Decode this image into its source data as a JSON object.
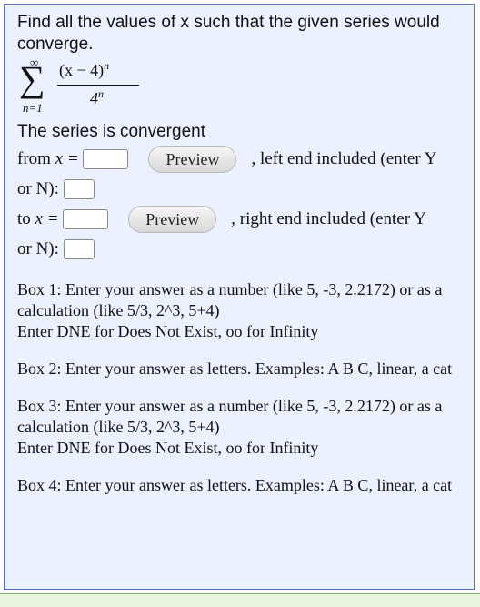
{
  "question": {
    "prompt": "Find all the values of x such that the given series would converge.",
    "series": {
      "upper_limit": "∞",
      "lower_limit": "n=1",
      "numerator": "(x − 4)",
      "numerator_exponent": "n",
      "denominator": "4",
      "denominator_exponent": "n"
    },
    "convergent_label": "The series is convergent",
    "from_label": "from",
    "to_label": "to",
    "x_eq": "x =",
    "preview_label": "Preview",
    "left_end_text": ", left end included (enter Y",
    "right_end_text": ", right end included (enter Y",
    "or_n_text": "or N):"
  },
  "hints": [
    {
      "line1": "Box 1: Enter your answer as a number (like 5, -3, 2.2172) or as a calculation (like 5/3, 2^3, 5+4)",
      "line2": "Enter DNE for Does Not Exist, oo for Infinity"
    },
    {
      "line1": "Box 2: Enter your answer as letters. Examples: A B C, linear, a cat"
    },
    {
      "line1": "Box 3: Enter your answer as a number (like 5, -3, 2.2172) or as a calculation (like 5/3, 2^3, 5+4)",
      "line2": "Enter DNE for Does Not Exist, oo for Infinity"
    },
    {
      "line1": "Box 4: Enter your answer as letters. Examples: A B C, linear, a cat"
    }
  ],
  "colors": {
    "panel_bg": "#ecf1ff",
    "panel_border": "#5a6fbe",
    "strip_bg": "#e8f6df"
  }
}
